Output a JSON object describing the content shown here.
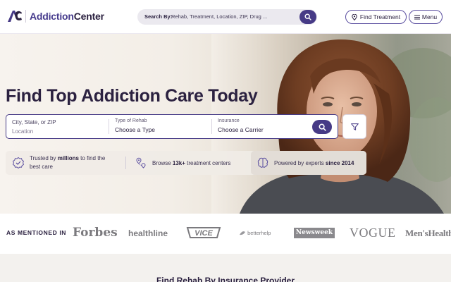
{
  "header": {
    "logo_text_brand": "Addiction",
    "logo_text_rest": "Center",
    "search_prefix": "Search By:",
    "search_placeholder": "Rehab, Treatment, Location, ZIP, Drug ...",
    "find_treatment_label": "Find Treatment",
    "menu_label": "Menu"
  },
  "hero": {
    "title": "Find Top Addiction Care Today",
    "fields": {
      "location_label": "City, State, or ZIP",
      "location_placeholder": "Location",
      "type_label": "Type of Rehab",
      "type_value": "Choose a Type",
      "insurance_label": "Insurance",
      "insurance_value": "Choose a Carrier"
    },
    "trust": {
      "t1_pre": "Trusted by ",
      "t1_bold": "millions",
      "t1_post": " to find the best care",
      "t2_pre": "Browse ",
      "t2_bold": "13k+",
      "t2_post": " treatment centers",
      "t3_pre": "Powered by experts ",
      "t3_bold": "since 2014"
    }
  },
  "mentioned": {
    "label": "AS MENTIONED IN",
    "brands": {
      "forbes": "Forbes",
      "healthline": "healthline",
      "vice": "VICE",
      "betterhelp": "betterhelp",
      "newsweek": "Newsweek",
      "vogue": "VOGUE",
      "menshealth": "Men'sHealth"
    }
  },
  "section": {
    "title": "Find Rehab By Insurance Provider"
  },
  "colors": {
    "primary": "#463a86",
    "text": "#2b2140"
  },
  "icons": [
    "search-icon",
    "location-pin-icon",
    "hamburger-icon",
    "filter-icon",
    "badge-check-icon",
    "map-pins-icon",
    "brain-icon"
  ]
}
